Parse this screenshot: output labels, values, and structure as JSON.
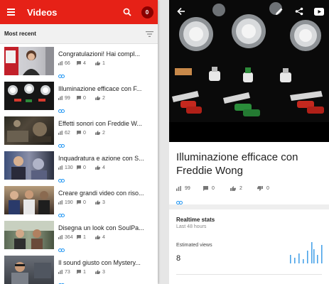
{
  "left_panel": {
    "app_title": "Videos",
    "notification_count": "0",
    "section_title": "Most recent",
    "videos": [
      {
        "title": "Congratulazioni! Hai compl...",
        "views": "66",
        "comments": "4",
        "likes": "1"
      },
      {
        "title": "Illuminazione efficace con F...",
        "views": "99",
        "comments": "0",
        "likes": "2"
      },
      {
        "title": "Effetti sonori con Freddie W...",
        "views": "62",
        "comments": "0",
        "likes": "2"
      },
      {
        "title": "Inquadratura e azione con S...",
        "views": "130",
        "comments": "0",
        "likes": "4"
      },
      {
        "title": "Creare grandi video con riso...",
        "views": "190",
        "comments": "0",
        "likes": "3"
      },
      {
        "title": "Disegna un look con SoulPa...",
        "views": "364",
        "comments": "1",
        "likes": "4"
      },
      {
        "title": "Il sound giusto con Mystery...",
        "views": "73",
        "comments": "1",
        "likes": "3"
      }
    ]
  },
  "right_panel": {
    "video_title": "Illuminazione efficace con Freddie Wong",
    "views": "99",
    "comments": "0",
    "likes": "2",
    "dislikes": "0",
    "realtime_title": "Realtime stats",
    "realtime_subtitle": "Last 48 hours",
    "estimated_views_label": "Estimated views",
    "estimated_views_value": "8"
  },
  "colors": {
    "accent": "#e62117",
    "link": "#2196f3"
  }
}
